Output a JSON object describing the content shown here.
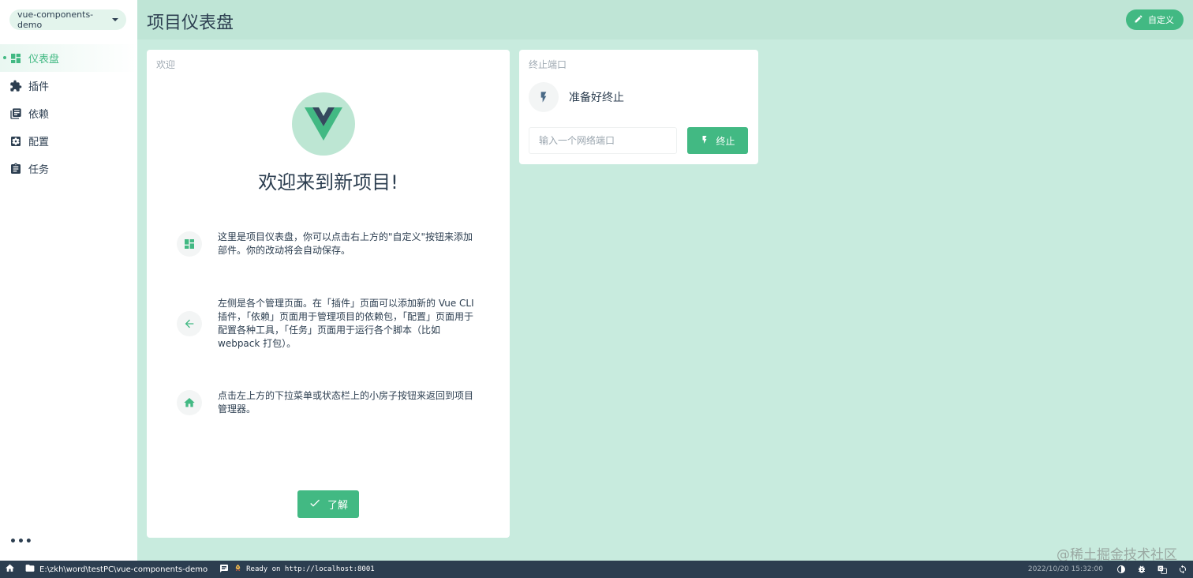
{
  "sidebar": {
    "project": "vue-components-demo",
    "items": [
      {
        "label": "仪表盘",
        "icon": "dashboard-icon",
        "active": true
      },
      {
        "label": "插件",
        "icon": "puzzle-icon"
      },
      {
        "label": "依赖",
        "icon": "library-books-icon"
      },
      {
        "label": "配置",
        "icon": "settings-applications-icon"
      },
      {
        "label": "任务",
        "icon": "assignment-icon"
      }
    ],
    "more": "•••"
  },
  "header": {
    "title": "项目仪表盘",
    "customize_label": "自定义"
  },
  "welcome": {
    "title": "欢迎",
    "heading": "欢迎来到新项目!",
    "tips": [
      {
        "icon": "dashboard-icon",
        "text": "这里是项目仪表盘，你可以点击右上方的\"自定义\"按钮来添加部件。你的改动将会自动保存。"
      },
      {
        "icon": "arrow-back-icon",
        "text": "左侧是各个管理页面。在「插件」页面可以添加新的 Vue CLI 插件，「依赖」页面用于管理项目的依赖包，「配置」页面用于配置各种工具，「任务」页面用于运行各个脚本（比如 webpack 打包）。"
      },
      {
        "icon": "home-icon",
        "text": "点击左上方的下拉菜单或状态栏上的小房子按钮来返回到项目管理器。"
      }
    ],
    "ok_label": "了解"
  },
  "killport": {
    "title": "终止端口",
    "status": "准备好终止",
    "input_placeholder": "输入一个网络端口",
    "button_label": "终止"
  },
  "watermark": "@稀土掘金技术社区",
  "statusbar": {
    "path": "E:\\zkh\\word\\testPC\\vue-components-demo",
    "log": "Ready on http://localhost:8001",
    "time": "2022/10/20 15:32:00"
  },
  "colors": {
    "accent": "#42b983",
    "background": "#c8ebde",
    "header": "#bfe5d6",
    "statusbar": "#2c3e50"
  }
}
